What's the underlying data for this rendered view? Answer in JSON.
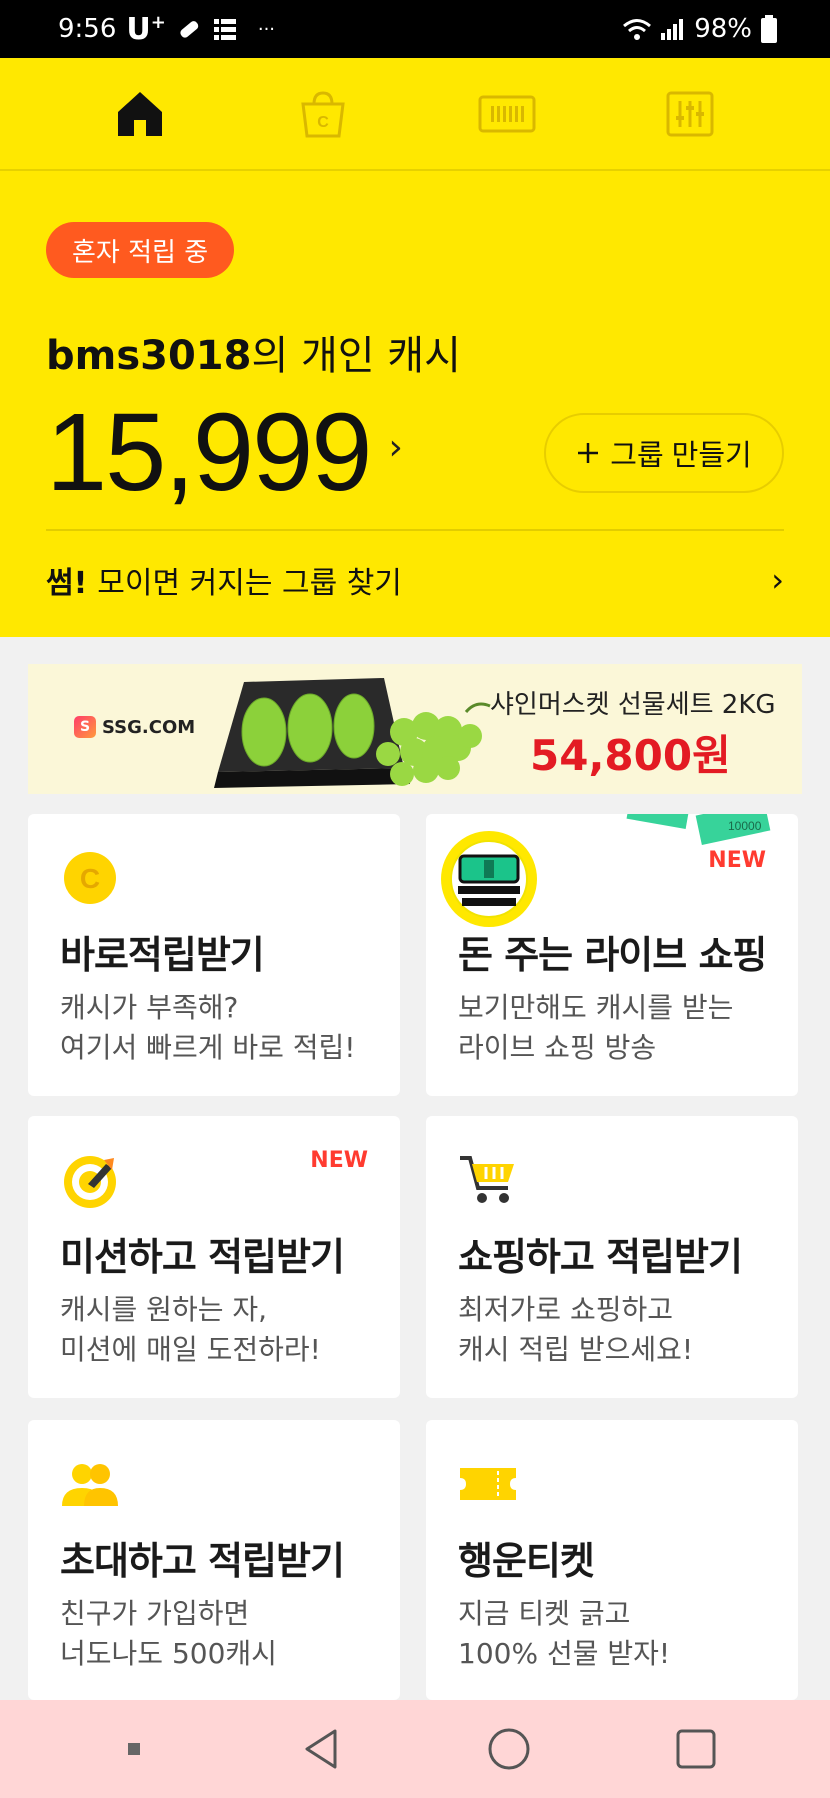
{
  "status": {
    "time": "9:56",
    "carrier": "U",
    "carrier_sup": "+",
    "dots": "···",
    "battery": "98%"
  },
  "nav": {
    "tabs": [
      "home-icon",
      "shopping-bag-icon",
      "barcode-icon",
      "settings-sliders-icon"
    ]
  },
  "hero": {
    "badge": "혼자 적립 중",
    "owner_id": "bms3018",
    "owner_suffix": "의 개인 캐시",
    "amount": "15,999",
    "group_button": "그룹 만들기",
    "find_bold": "썸!",
    "find_text": "모이면 커지는 그룹 찾기"
  },
  "banner": {
    "brand": "SSG.COM",
    "title": "샤인머스켓 선물세트 2KG",
    "price": "54,800원"
  },
  "cards": [
    {
      "title": "바로적립받기",
      "desc1": "캐시가 부족해?",
      "desc2": "여기서 빠르게 바로 적립!",
      "new": ""
    },
    {
      "title": "돈 주는 라이브 쇼핑",
      "desc1": "보기만해도 캐시를 받는",
      "desc2": "라이브 쇼핑 방송",
      "new": "NEW"
    },
    {
      "title": "미션하고 적립받기",
      "desc1": "캐시를 원하는 자,",
      "desc2": "미션에 매일 도전하라!",
      "new": "NEW"
    },
    {
      "title": "쇼핑하고 적립받기",
      "desc1": "최저가로 쇼핑하고",
      "desc2": "캐시 적립 받으세요!",
      "new": ""
    },
    {
      "title": "초대하고 적립받기",
      "desc1": "친구가 가입하면",
      "desc2": "너도나도 500캐시",
      "new": ""
    },
    {
      "title": "행운티켓",
      "desc1": "지금 티켓 긁고",
      "desc2": "100% 선물 받자!",
      "new": ""
    }
  ],
  "colors": {
    "brand_yellow": "#ffe800",
    "badge_orange": "#ff5a1f",
    "new_red": "#ff3b30",
    "price_red": "#e31b23"
  }
}
